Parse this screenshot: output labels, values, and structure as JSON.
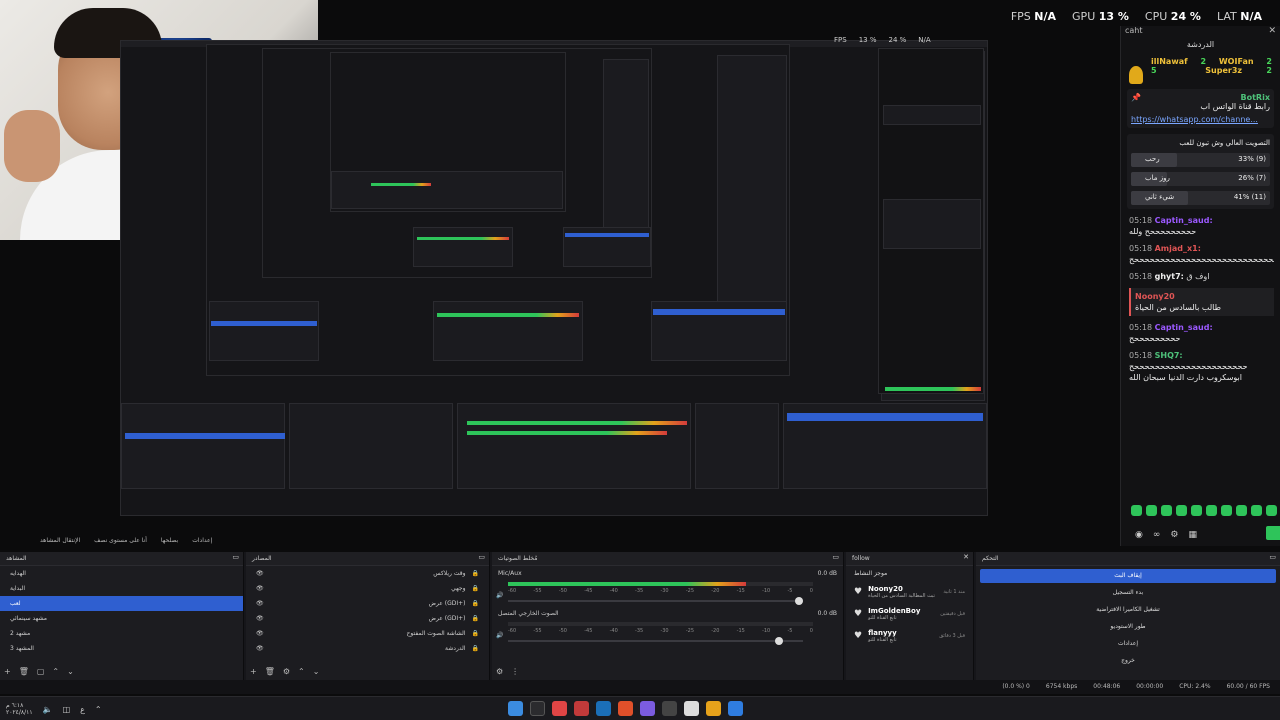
{
  "stats": {
    "fps_label": "FPS",
    "fps_value": "N/A",
    "gpu_label": "GPU",
    "gpu_value": "13 %",
    "cpu_label": "CPU",
    "cpu_value": "24 %",
    "lat_label": "LAT",
    "lat_value": "N/A"
  },
  "chat": {
    "panel_label": "caht",
    "header": "الدردشة",
    "leaders": [
      {
        "name": "illNawaf",
        "rank": "2",
        "name2": "WOIFan",
        "rank2": "2"
      },
      {
        "name": "5",
        "rank": "",
        "name2": "Super3z",
        "rank2": "2"
      }
    ],
    "pinned_who": "BotRix",
    "pinned_text": "رابط قناة الواتس اب",
    "pinned_link": "https://whatsapp.com/channe...",
    "poll_question": "التصويت العالي وش تبون للعب",
    "poll": [
      {
        "option": "رحب",
        "pct": "33% (9)",
        "fill": 0.33
      },
      {
        "option": "روز ماب",
        "pct": "26% (7)",
        "fill": 0.26
      },
      {
        "option": "شيء ثاني",
        "pct": "41% (11)",
        "fill": 0.41
      }
    ],
    "messages": [
      {
        "time": "05:18",
        "user": "Captin_saud:",
        "color": "#9b59ff",
        "body": "حححححححححح ولله"
      },
      {
        "time": "05:18",
        "user": "Amjad_x1:",
        "color": "#e05555",
        "body": "ححححححححححححححححححححححححححححححححح"
      },
      {
        "time": "05:18",
        "user": "ghyt7:",
        "color": "#eeeeee",
        "body": "اوف ق"
      },
      {
        "time": "",
        "user": "Noony20",
        "color": "#e05555",
        "body": "طالب بالسادس من الحياة",
        "highlight": true
      },
      {
        "time": "05:18",
        "user": "Captin_saud:",
        "color": "#9b59ff",
        "body": "حححححححححح"
      },
      {
        "time": "05:18",
        "user": "SHQ7:",
        "color": "#4ec27a",
        "body": "ححححححححححححححححححححححح"
      },
      {
        "time": "",
        "user": "",
        "color": "#eeeeee",
        "body": "ابوسكروب دارت الدنيا سبحان الله"
      }
    ]
  },
  "obs": {
    "top_items": [
      "الإنتقال المشاهد",
      "أنا على مستوى نصف",
      "بصلحها",
      "إعدادات"
    ],
    "scenes_title": "المشاهد",
    "scenes": [
      "الهدايه",
      "البداية",
      "لعب",
      "مشهد سينمائي",
      "مشهد 2",
      "المشهد 3"
    ],
    "sources_title": "المصادر",
    "sources": [
      "وقت ريلاكس",
      "وجهي",
      "عرض (GDI+)",
      "عرض (GDI+)",
      "الشاشة الصوت المفتوح",
      "الدردشة"
    ],
    "mixer_title": "مُخلط الصوتيات",
    "mixer_channels": [
      {
        "name": "Mic/Aux",
        "db": "0.0 dB",
        "level": 0.78
      },
      {
        "name": "الصوت الخارجي المتصل",
        "db": "0.0 dB",
        "level": 0.0
      }
    ],
    "mixer_scale": [
      "-60",
      "-55",
      "-50",
      "-45",
      "-40",
      "-35",
      "-30",
      "-25",
      "-20",
      "-15",
      "-10",
      "-5",
      "0"
    ],
    "follow_title": "follow",
    "follow_sub": "موجز النشاط",
    "follows": [
      {
        "name": "Noony20",
        "sub": "تبث المطالبة السادس من الحياة",
        "ago": "منذ 1 ثانية"
      },
      {
        "name": "ImGoldenBoy",
        "sub": "تابع القناة للتو",
        "ago": "قبل دقيقتين"
      },
      {
        "name": "flanyyy",
        "sub": "تابع القناة للتو",
        "ago": "قبل 3 دقائق"
      }
    ],
    "controls_title": "التحكم",
    "controls": [
      "إيقاف البث",
      "بدء التسجيل",
      "تشغيل الكاميرا الافتراضية",
      "طور الاستوديو",
      "إعدادات",
      "خروج"
    ]
  },
  "status": {
    "dropped": "(0.0 %) 0",
    "bitrate": "6754 kbps",
    "live_time": "00:48:06",
    "rec_time": "00:00:00",
    "cpu": "CPU: 2.4%",
    "fps": "60.00 / 60 FPS"
  },
  "taskbar": {
    "time": "٦:١٨ م",
    "date": "٢٠٢٤/٨/١١"
  }
}
